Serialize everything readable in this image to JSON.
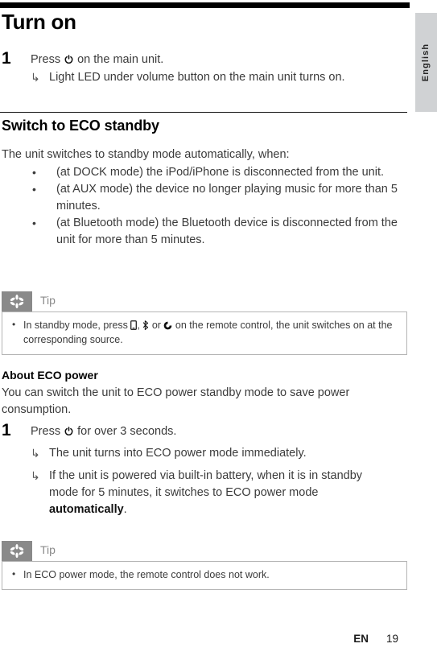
{
  "colors": {
    "rule": "#111111",
    "tip_header_bg": "#8a8a8a",
    "tip_border": "#b5b5b5",
    "language_tab_bg": "#d0d2d4",
    "body_text": "#3b3b3b"
  },
  "language_tab": {
    "label": "English"
  },
  "sections": {
    "turn_on": {
      "heading": "Turn on",
      "step_number": "1",
      "step_text_before_icon": "Press ",
      "step_icon": "power-icon",
      "step_text_after_icon": " on the main unit.",
      "result": "Light LED under volume button on the main unit turns on."
    },
    "eco_standby": {
      "heading": "Switch to ECO standby",
      "intro": "The unit switches to standby mode automatically, when:",
      "bullets": [
        "(at DOCK mode) the iPod/iPhone is disconnected from the unit.",
        "(at AUX mode) the device no longer playing music for more than 5 minutes.",
        "(at Bluetooth mode) the Bluetooth device is disconnected from the unit for more than 5 minutes."
      ]
    },
    "tip_one": {
      "title": "Tip",
      "icon": "asterisk-icon",
      "text_part1": "In standby mode, press ",
      "icon1": "dock-icon",
      "separator1": ", ",
      "icon2": "bluetooth-icon",
      "separator2": " or ",
      "icon3": "aux-icon",
      "text_part2": " on the remote control, the unit switches on at the corresponding source."
    },
    "eco_power": {
      "heading": "About ECO power",
      "intro": "You can switch the unit to ECO power standby mode to save power consumption.",
      "step_number": "1",
      "step_text_before_icon": "Press ",
      "step_icon": "power-icon",
      "step_text_after_icon": " for over 3 seconds.",
      "result_one": "The unit turns into ECO power mode immediately.",
      "result_two_part1": "If the unit is powered via built-in battery, when it is in standby mode for 5 minutes, it switches to ECO power mode ",
      "result_two_bold": "automatically",
      "result_two_part2": "."
    },
    "tip_two": {
      "title": "Tip",
      "icon": "asterisk-icon",
      "text": "In ECO power mode, the remote control does not work."
    }
  },
  "footer": {
    "language_code": "EN",
    "page_number": "19"
  },
  "glyphs": {
    "arrow": "↳",
    "bullet": "•"
  }
}
